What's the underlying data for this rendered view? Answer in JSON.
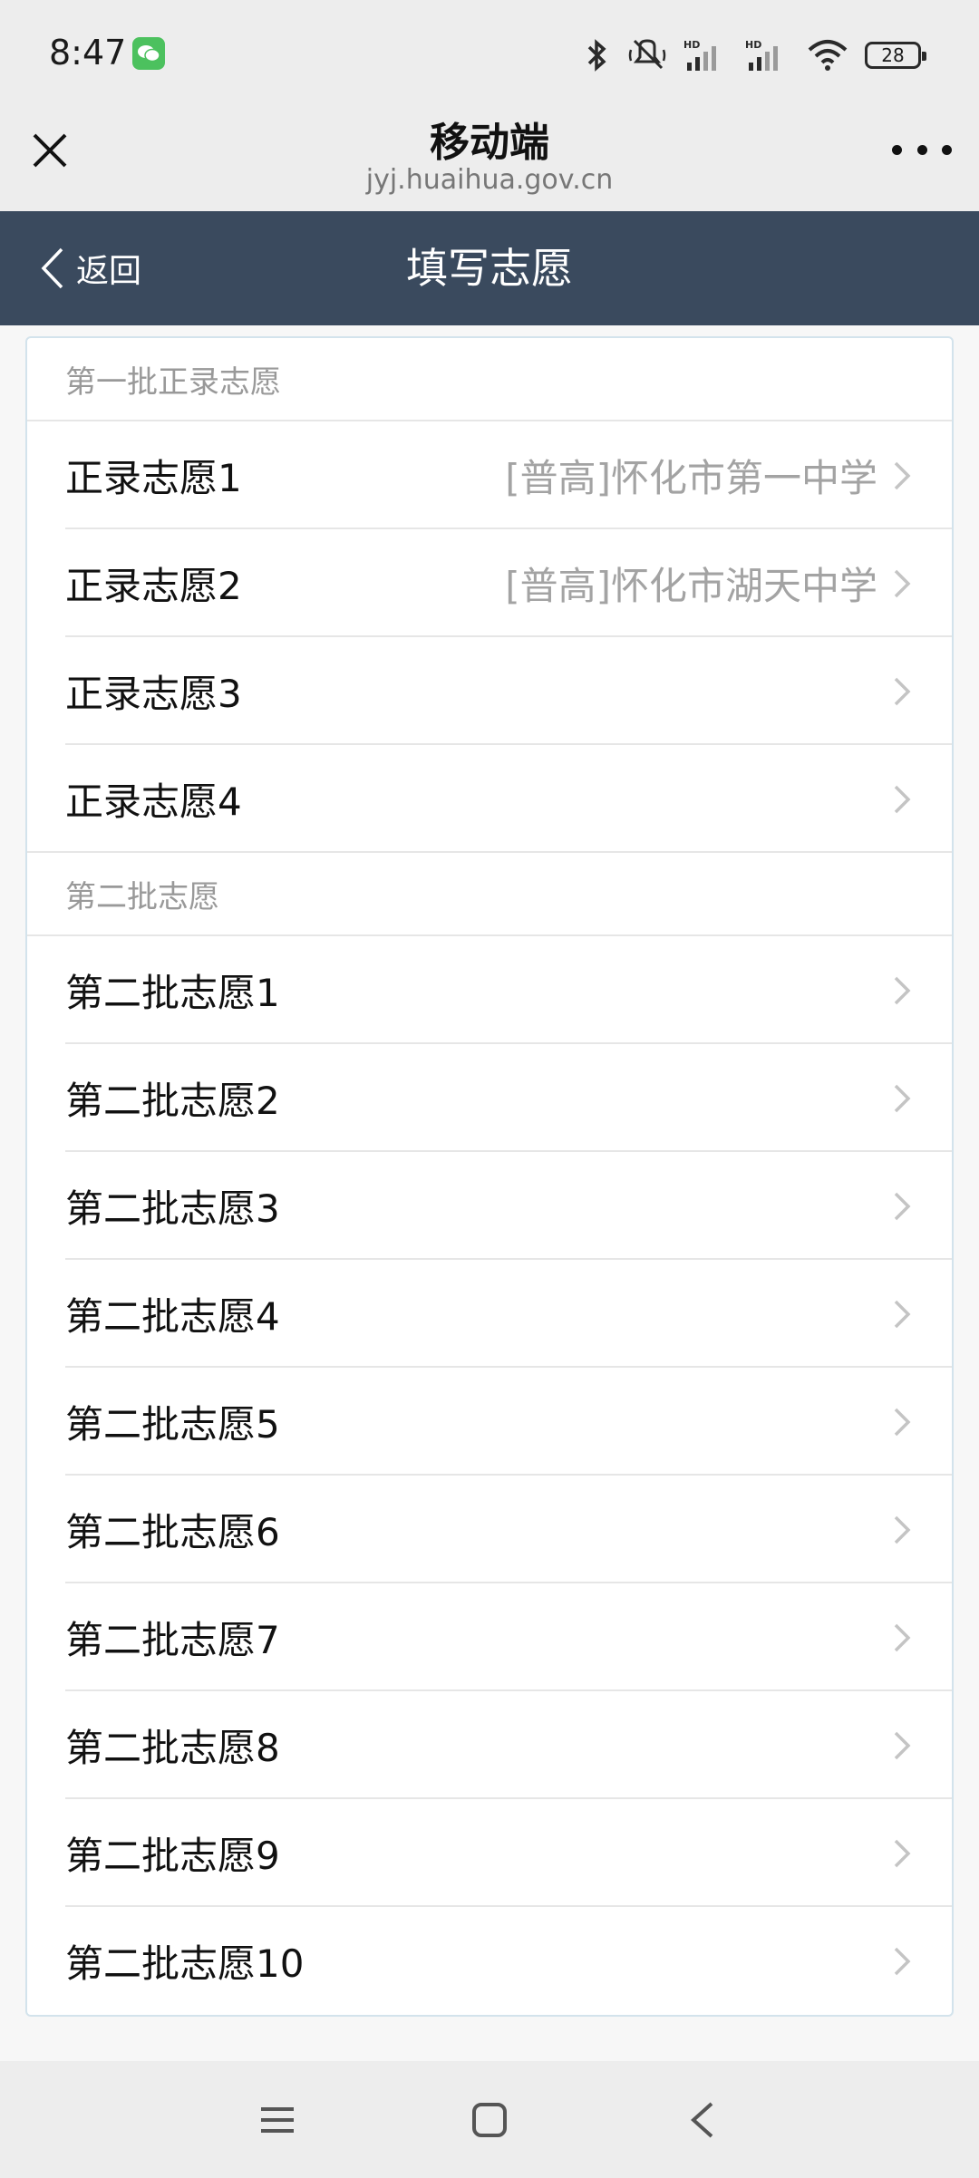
{
  "status": {
    "time": "8:47",
    "battery": "28"
  },
  "browser": {
    "title": "移动端",
    "domain": "jyj.huaihua.gov.cn"
  },
  "header": {
    "back_label": "返回",
    "title": "填写志愿"
  },
  "section1": {
    "title": "第一批正录志愿",
    "items": [
      {
        "label": "正录志愿1",
        "value": "[普高]怀化市第一中学"
      },
      {
        "label": "正录志愿2",
        "value": "[普高]怀化市湖天中学"
      },
      {
        "label": "正录志愿3",
        "value": ""
      },
      {
        "label": "正录志愿4",
        "value": ""
      }
    ]
  },
  "section2": {
    "title": "第二批志愿",
    "items": [
      {
        "label": "第二批志愿1"
      },
      {
        "label": "第二批志愿2"
      },
      {
        "label": "第二批志愿3"
      },
      {
        "label": "第二批志愿4"
      },
      {
        "label": "第二批志愿5"
      },
      {
        "label": "第二批志愿6"
      },
      {
        "label": "第二批志愿7"
      },
      {
        "label": "第二批志愿8"
      },
      {
        "label": "第二批志愿9"
      },
      {
        "label": "第二批志愿10"
      }
    ]
  },
  "colors": {
    "header_bg": "#3a4a5e",
    "wechat": "#4cc15e"
  }
}
